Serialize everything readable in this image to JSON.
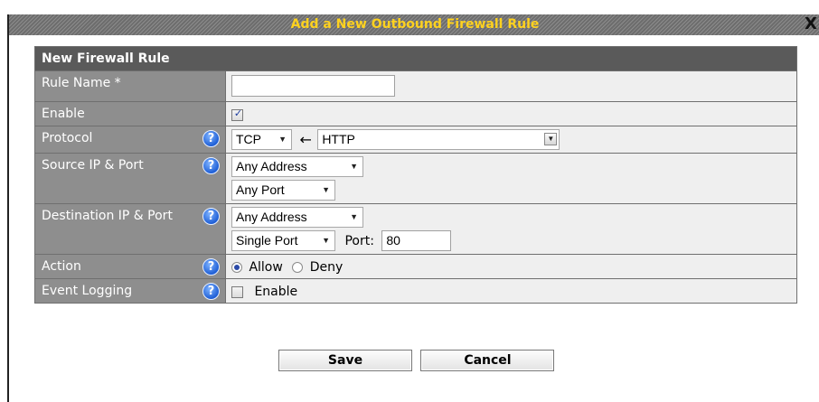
{
  "dialog": {
    "title": "Add a New Outbound Firewall Rule",
    "close_label": "X"
  },
  "form": {
    "section_title": "New Firewall Rule",
    "rule_name": {
      "label": "Rule Name *",
      "value": ""
    },
    "enable": {
      "label": "Enable",
      "checked": true,
      "check_glyph": "✓"
    },
    "protocol": {
      "label": "Protocol",
      "protocol_value": "TCP",
      "service_value": "HTTP",
      "arrow": "←"
    },
    "source": {
      "label": "Source IP & Port",
      "address_value": "Any Address",
      "port_value": "Any Port"
    },
    "destination": {
      "label": "Destination IP & Port",
      "address_value": "Any Address",
      "port_mode_value": "Single Port",
      "port_label": "Port:",
      "port_value": "80"
    },
    "action": {
      "label": "Action",
      "options": [
        "Allow",
        "Deny"
      ],
      "selected": "Allow"
    },
    "event_logging": {
      "label": "Event Logging",
      "checkbox_label": "Enable",
      "checked": false
    },
    "help_glyph": "?"
  },
  "buttons": {
    "save_label": "Save",
    "cancel_label": "Cancel"
  },
  "icons": {
    "help": "question-mark-circle-icon",
    "dropdown": "triangle-down-icon",
    "arrow": "left-arrow-icon",
    "close": "close-x-icon"
  },
  "colors": {
    "title_text": "#ffd21f",
    "header_bg": "#5a5a5a",
    "label_bg": "#8e8e8e",
    "value_bg": "#efefef",
    "help_icon": "#1f5fd6"
  }
}
